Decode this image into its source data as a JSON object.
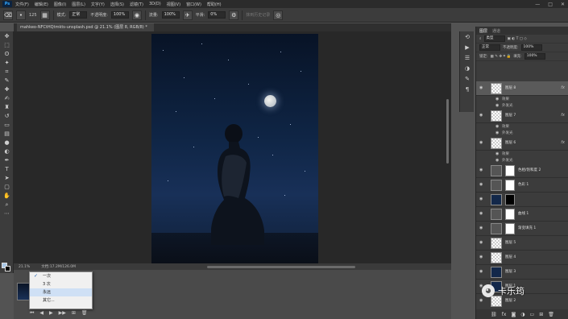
{
  "menubar": {
    "logo": "Ps",
    "items": [
      "文件(F)",
      "编辑(E)",
      "图像(I)",
      "图层(L)",
      "文字(Y)",
      "选择(S)",
      "滤镜(T)",
      "3D(D)",
      "视图(V)",
      "窗口(W)",
      "帮助(H)"
    ],
    "win_controls": [
      "—",
      "□",
      "✕"
    ]
  },
  "options": {
    "brush_size": "125",
    "mode_label": "模式:",
    "mode_value": "正常",
    "opacity_label": "不透明度:",
    "opacity_value": "100%",
    "flow_label": "流量:",
    "flow_value": "100%",
    "smooth_label": "平滑:",
    "smooth_value": "0%",
    "erase_history": "抹到历史记录"
  },
  "document": {
    "tab_title": "mahkeo-NFCtHQtmkts-unsplash.psd @ 21.1% (图层 8, RGB/8) *",
    "zoom": "21.1%",
    "doc_info": "文档:17.2M/126.0M"
  },
  "timeline": {
    "loop_options": [
      {
        "label": "一次",
        "checked": true
      },
      {
        "label": "3 次",
        "checked": false
      },
      {
        "label": "永远",
        "checked": false
      },
      {
        "label": "其它...",
        "checked": false
      }
    ],
    "highlighted_index": 2,
    "controls": [
      "⏮",
      "◀",
      "▶",
      "▶▶",
      "⊞",
      "🗑"
    ]
  },
  "layers_panel": {
    "tabs": [
      "图层",
      "通道"
    ],
    "kind_label": "类型",
    "blend_mode": "正常",
    "opacity_label": "不透明度:",
    "opacity_value": "100%",
    "lock_label": "锁定:",
    "fill_label": "填充:",
    "fill_value": "100%",
    "layers": [
      {
        "name": "图层 8",
        "selected": true,
        "fx": true,
        "thumb": "transparent"
      },
      {
        "sub": true,
        "name": "效果"
      },
      {
        "sub": true,
        "name": "外发光"
      },
      {
        "name": "图层 7",
        "fx": true,
        "thumb": "transparent"
      },
      {
        "sub": true,
        "name": "效果"
      },
      {
        "sub": true,
        "name": "外发光"
      },
      {
        "name": "图层 6",
        "fx": true,
        "thumb": "transparent"
      },
      {
        "sub": true,
        "name": "效果"
      },
      {
        "sub": true,
        "name": "外发光"
      },
      {
        "name": "色相/饱和度 2",
        "thumb": "adj",
        "mask": "white"
      },
      {
        "name": "色彩 1",
        "thumb": "adj",
        "mask": "white"
      },
      {
        "name": "",
        "thumb": "dark",
        "mask": "black"
      },
      {
        "name": "曲线 1",
        "thumb": "adj",
        "mask": "white"
      },
      {
        "name": "渐变填充 1",
        "thumb": "adj",
        "mask": "white"
      },
      {
        "name": "图层 5",
        "thumb": "transparent"
      },
      {
        "name": "图层 4",
        "thumb": "transparent"
      },
      {
        "name": "图层 3",
        "thumb": "dark"
      },
      {
        "name": "图层 1",
        "thumb": "dark"
      },
      {
        "name": "图层 2",
        "thumb": "transparent"
      }
    ],
    "footer_icons": [
      "link-icon",
      "fx-icon",
      "mask-icon",
      "adjustment-icon",
      "folder-icon",
      "new-layer-icon",
      "trash-icon"
    ]
  },
  "watermark": {
    "text": "卡乐筠"
  }
}
